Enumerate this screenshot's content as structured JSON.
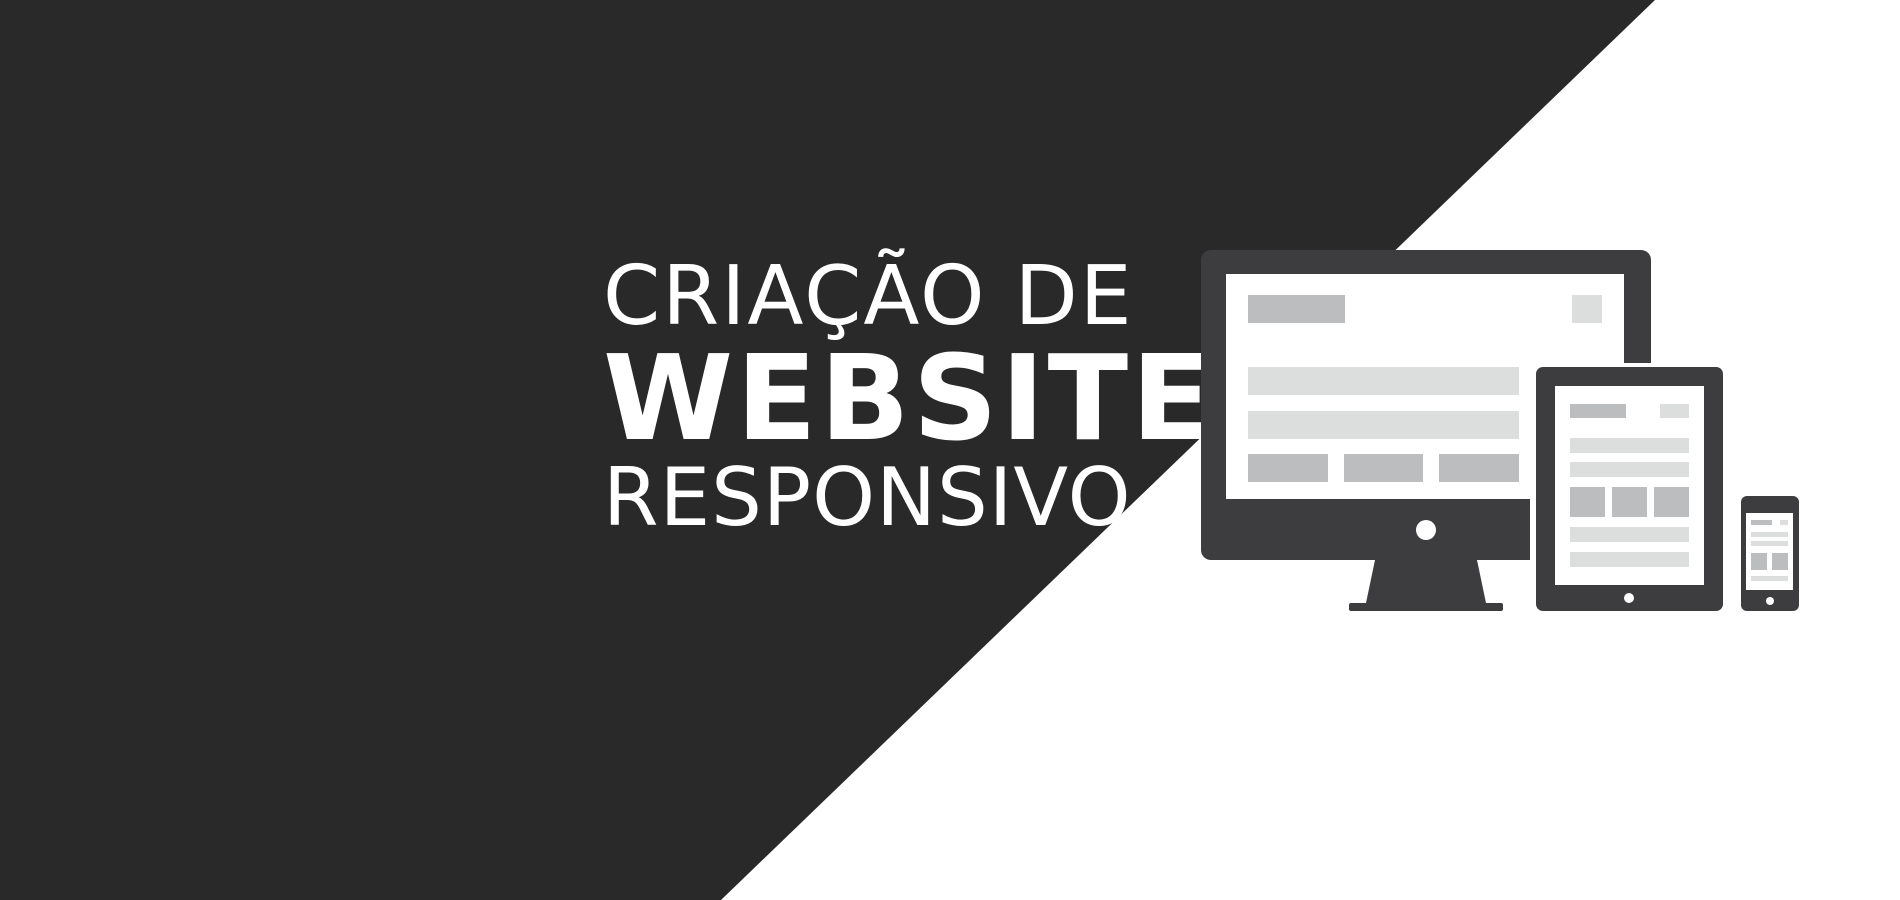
{
  "headline": {
    "line1": "CRIAÇÃO DE",
    "line2": "WEBSITE",
    "line3": "RESPONSIVO"
  },
  "colors": {
    "dark_background": "#292929",
    "light_background": "#ffffff",
    "device_frame": "#3d3d3f",
    "screen": "#ffffff",
    "block_dark": "#bcbdbf",
    "block_light": "#dcdedd",
    "headline_text": "#ffffff"
  },
  "illustration": {
    "icons": [
      "desktop-monitor-icon",
      "tablet-icon",
      "smartphone-icon"
    ]
  }
}
